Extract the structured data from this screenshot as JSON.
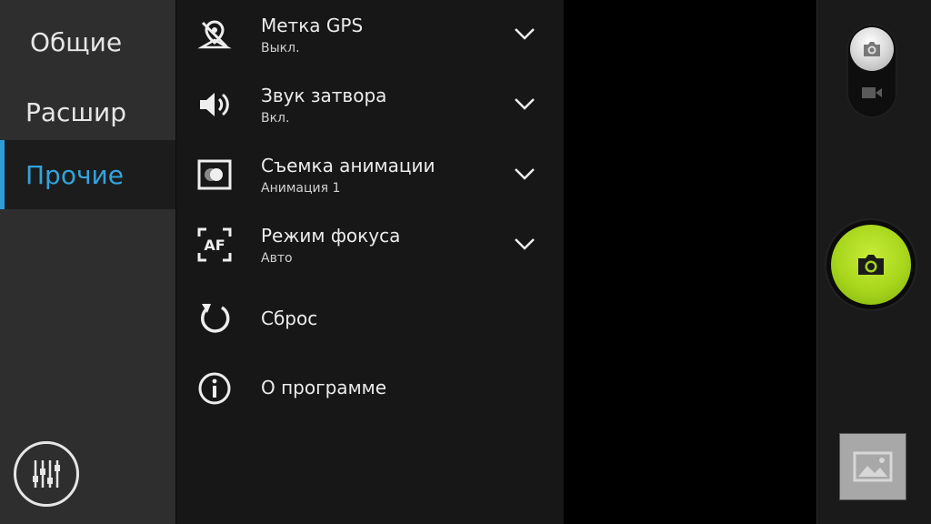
{
  "sidebar": {
    "categories": [
      {
        "label": "Общие",
        "selected": false
      },
      {
        "label": "Расшир",
        "selected": false
      },
      {
        "label": "Прочие",
        "selected": true
      }
    ],
    "settings_icon": "sliders-icon"
  },
  "settings": [
    {
      "title": "Метка GPS",
      "value": "Выкл.",
      "icon": "gps-off-icon",
      "has_dropdown": true
    },
    {
      "title": "Звук затвора",
      "value": "Вкл.",
      "icon": "speaker-icon",
      "has_dropdown": true
    },
    {
      "title": "Съемка анимации",
      "value": "Анимация 1",
      "icon": "animation-icon",
      "has_dropdown": true
    },
    {
      "title": "Режим фокуса",
      "value": "Авто",
      "icon": "autofocus-icon",
      "has_dropdown": true
    },
    {
      "title": "Сброс",
      "icon": "reset-icon",
      "has_dropdown": false
    },
    {
      "title": "О программе",
      "icon": "info-icon",
      "has_dropdown": false
    }
  ],
  "af_icon_text": "AF",
  "controls": {
    "mode": "photo",
    "mode_icons": [
      "camera-icon",
      "video-camera-icon"
    ],
    "shutter_icon": "camera-icon",
    "gallery_icon": "image-icon"
  },
  "colors": {
    "accent": "#2f9ed8",
    "shutter": "#a8d61c",
    "sidebar_bg": "#2e2e2e",
    "panel_bg": "#171717"
  }
}
